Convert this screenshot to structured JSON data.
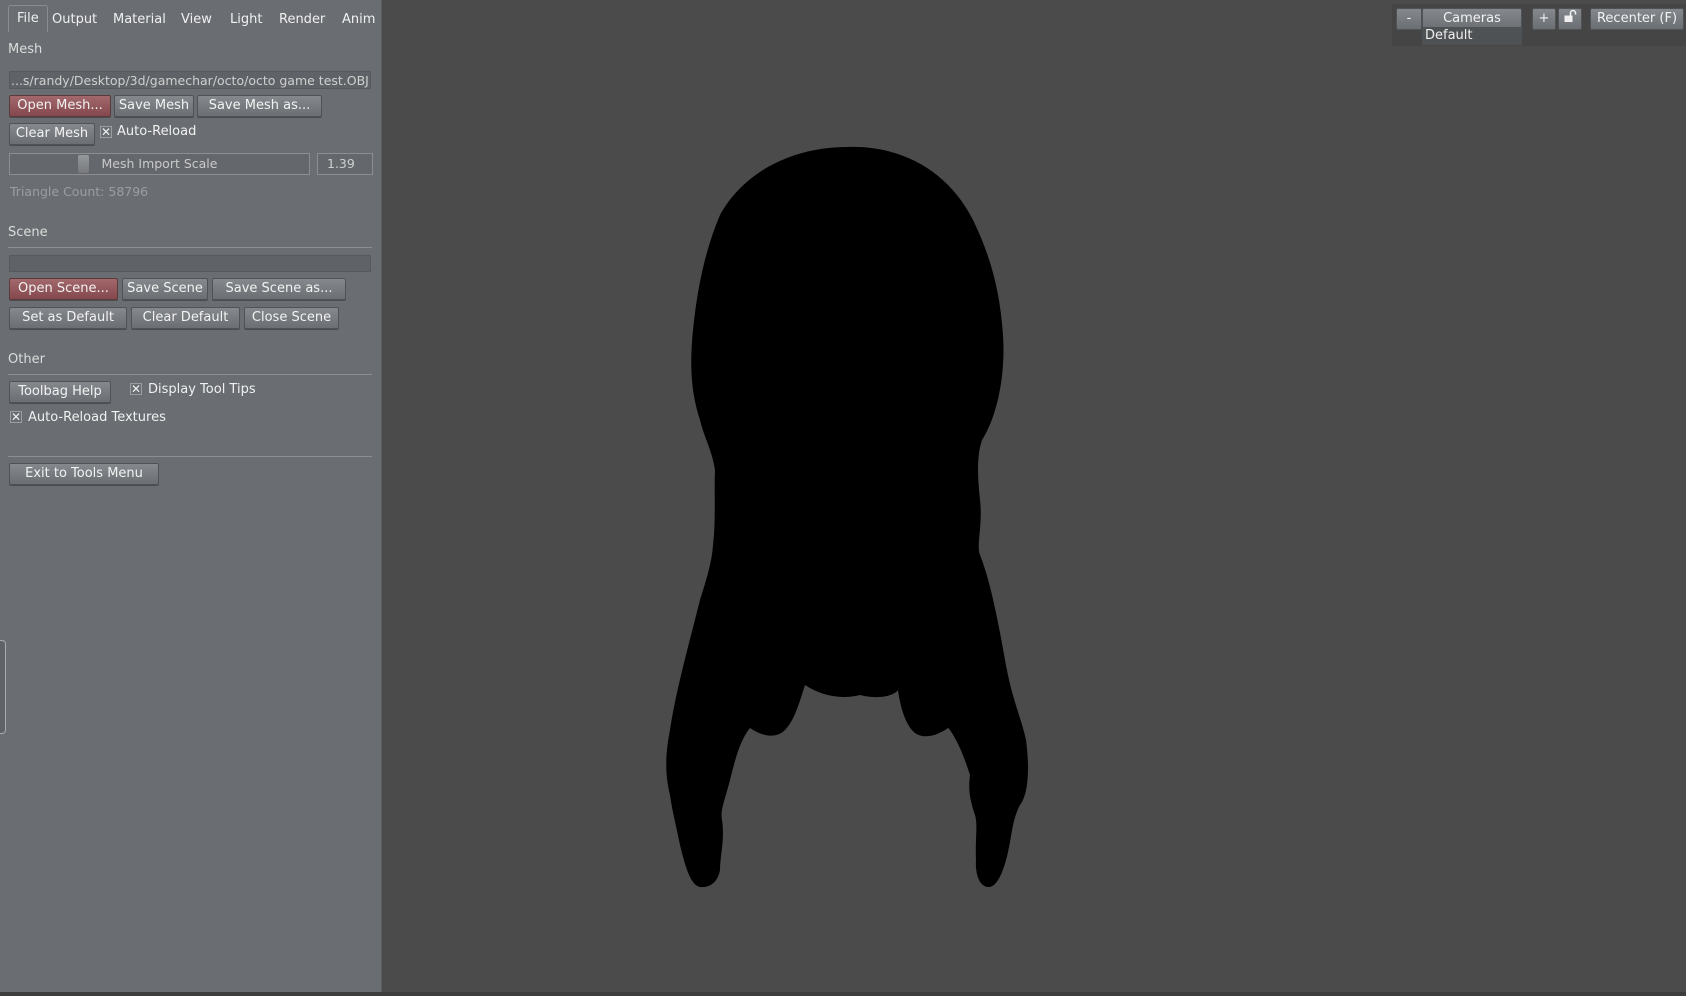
{
  "menu": {
    "tabs": [
      "File",
      "Output",
      "Material",
      "View",
      "Light",
      "Render",
      "Anim"
    ],
    "active": "File"
  },
  "mesh": {
    "title": "Mesh",
    "path": "...s/randy/Desktop/3d/gamechar/octo/octo game test.OBJ",
    "open_label": "Open Mesh...",
    "save_label": "Save Mesh",
    "save_as_label": "Save Mesh as...",
    "clear_label": "Clear Mesh",
    "auto_reload_label": "Auto-Reload",
    "auto_reload_checked": true,
    "scale_label": "Mesh Import Scale",
    "scale_value": "1.39",
    "triangle_count": "Triangle Count: 58796"
  },
  "scene": {
    "title": "Scene",
    "open_label": "Open Scene...",
    "save_label": "Save Scene",
    "save_as_label": "Save Scene as...",
    "set_default_label": "Set as Default",
    "clear_default_label": "Clear Default",
    "close_label": "Close Scene"
  },
  "other": {
    "title": "Other",
    "help_label": "Toolbag Help",
    "tooltips_label": "Display Tool Tips",
    "tooltips_checked": true,
    "auto_reload_textures_label": "Auto-Reload Textures",
    "auto_reload_textures_checked": true,
    "exit_label": "Exit to Tools Menu"
  },
  "cameras": {
    "minus_label": "-",
    "title": "Cameras",
    "plus_label": "+",
    "current": "Default",
    "recenter_label": "Recenter (F)",
    "lock_icon": "lock-open-icon"
  },
  "colors": {
    "panel": "#6a6e72",
    "viewport": "#4b4b4b",
    "accent_button": "#9a5f63",
    "model": "#000000"
  }
}
